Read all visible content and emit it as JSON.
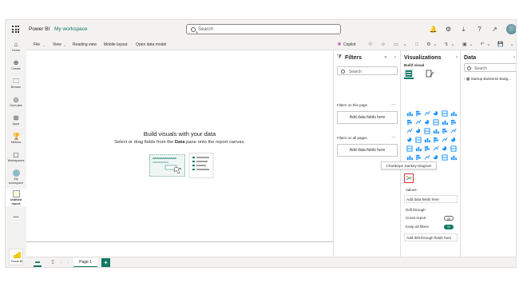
{
  "header": {
    "app_name": "Power BI",
    "workspace": "My workspace",
    "search_placeholder": "Search"
  },
  "nav": {
    "items": [
      {
        "label": "Home",
        "icon": "home-icon"
      },
      {
        "label": "Create",
        "icon": "create-icon"
      },
      {
        "label": "Browse",
        "icon": "browse-icon"
      },
      {
        "label": "OneLake",
        "icon": "onelake-icon"
      },
      {
        "label": "Apps",
        "icon": "apps-icon"
      },
      {
        "label": "Metrics",
        "icon": "metrics-icon"
      },
      {
        "label": "Workspaces",
        "icon": "workspaces-icon"
      },
      {
        "label": "My workspace",
        "icon": "my-workspace-icon"
      },
      {
        "label": "Untitled report",
        "icon": "report-icon"
      },
      {
        "label": "...",
        "icon": "more-icon"
      }
    ],
    "brand_label": "Power BI"
  },
  "ribbon": {
    "file": "File",
    "view": "View",
    "reading_view": "Reading view",
    "mobile_layout": "Mobile layout",
    "open_data_model": "Open data model",
    "copilot": "Copilot"
  },
  "canvas": {
    "title": "Build visuals with your data",
    "subtitle_pre": "Select or drag fields from the",
    "subtitle_bold": "Data",
    "subtitle_post": "pane onto the report canvas."
  },
  "pages": {
    "tab_label": "Page 1",
    "add_label": "+"
  },
  "filters": {
    "title": "Filters",
    "search_placeholder": "Search",
    "on_this_page": "Filters on this page",
    "on_all_pages": "Filters on all pages",
    "add_fields": "Add data fields here"
  },
  "visualizations": {
    "title": "Visualizations",
    "build_visual": "Build visual",
    "tooltip": "ChartExpo Sankey Diagram",
    "values_label": "Values",
    "values_placeholder": "Add data fields here",
    "drill_through": "Drill through",
    "cross_report": "Cross-report",
    "cross_report_state": "Off",
    "keep_all_filters": "Keep all filters",
    "keep_all_filters_state": "On",
    "drill_placeholder": "Add drill-through fields here"
  },
  "data": {
    "title": "Data",
    "search_placeholder": "Search",
    "tables": [
      "Startup Business Budg..."
    ]
  },
  "colors": {
    "accent": "#117865",
    "brand": "#f2c811",
    "highlight": "#d13438",
    "chart_blue": "#118dff"
  }
}
